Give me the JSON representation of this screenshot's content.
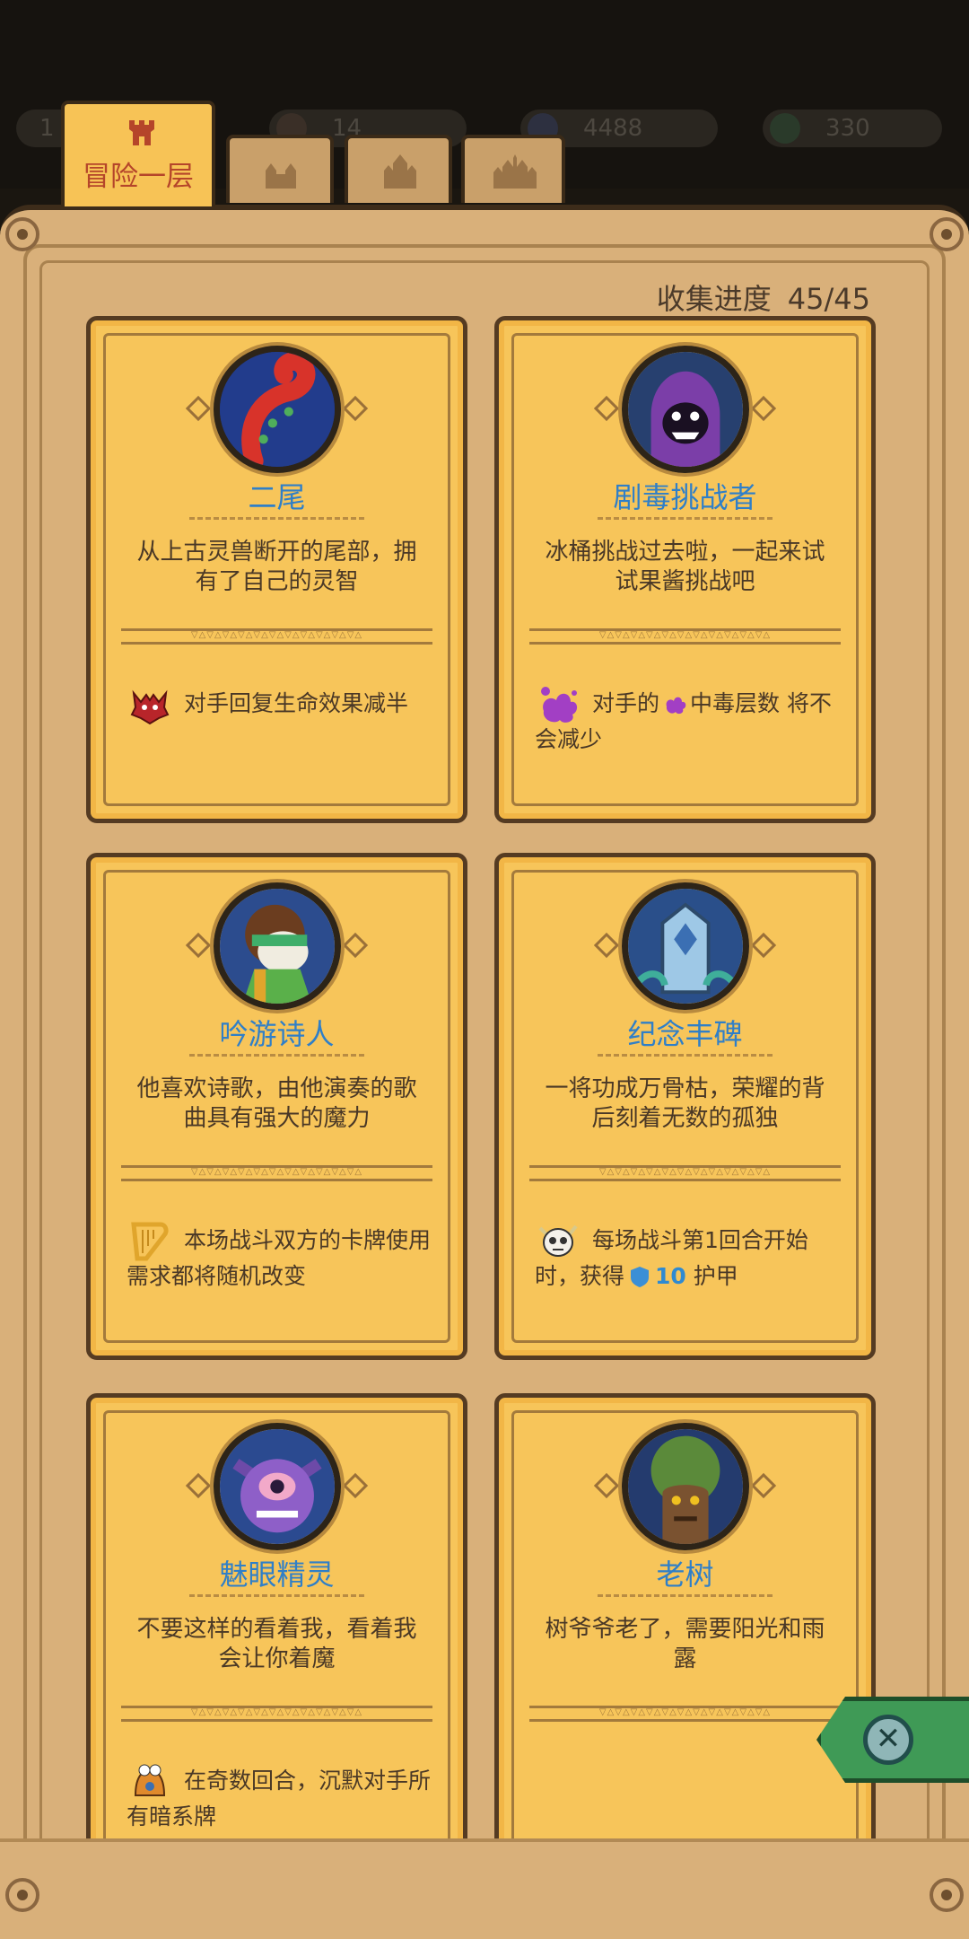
{
  "header": {
    "ghost_stats": [
      "1",
      "14",
      "4488",
      "330"
    ]
  },
  "tabs": [
    {
      "label": "冒险一层",
      "active": true,
      "icon": "tower-icon"
    },
    {
      "label": "",
      "active": false,
      "icon": "castle-small-icon"
    },
    {
      "label": "",
      "active": false,
      "icon": "castle-medium-icon"
    },
    {
      "label": "",
      "active": false,
      "icon": "castle-large-icon"
    }
  ],
  "collection": {
    "label": "收集进度",
    "count": "45/45"
  },
  "cards": [
    {
      "name": "二尾",
      "desc": "从上古灵兽断开的尾部，拥有了自己的灵智",
      "effect_icon": "horned-beast-icon",
      "effect_text": "对手回复生命效果减半"
    },
    {
      "name": "剧毒挑战者",
      "desc": "冰桶挑战过去啦，一起来试试果酱挑战吧",
      "effect_icon": "poison-splat-icon",
      "effect_text_a": "对手的",
      "effect_text_b": "中毒层数 将不会减少"
    },
    {
      "name": "吟游诗人",
      "desc": "他喜欢诗歌，由他演奏的歌曲具有强大的魔力",
      "effect_icon": "harp-icon",
      "effect_text": "本场战斗双方的卡牌使用需求都将随机改变"
    },
    {
      "name": "纪念丰碑",
      "desc": "一将功成万骨枯，荣耀的背后刻着无数的孤独",
      "effect_icon": "skull-icon",
      "effect_text_a": "每场战斗第1回合开始时，获得",
      "armor_value": "10",
      "effect_text_b": "护甲"
    },
    {
      "name": "魅眼精灵",
      "desc": "不要这样的看着我，看着我会让你着魔",
      "effect_icon": "bell-creature-icon",
      "effect_text": "在奇数回合，沉默对手所有暗系牌"
    },
    {
      "name": "老树",
      "desc": "树爷爷老了，需要阳光和雨露",
      "effect_icon": "",
      "effect_text": ""
    }
  ],
  "colors": {
    "card_bg": "#f7c55a",
    "name_blue": "#2f7fc8",
    "panel": "#d9b07a",
    "tab_active": "#f7c356",
    "close_green": "#3f9a56"
  }
}
